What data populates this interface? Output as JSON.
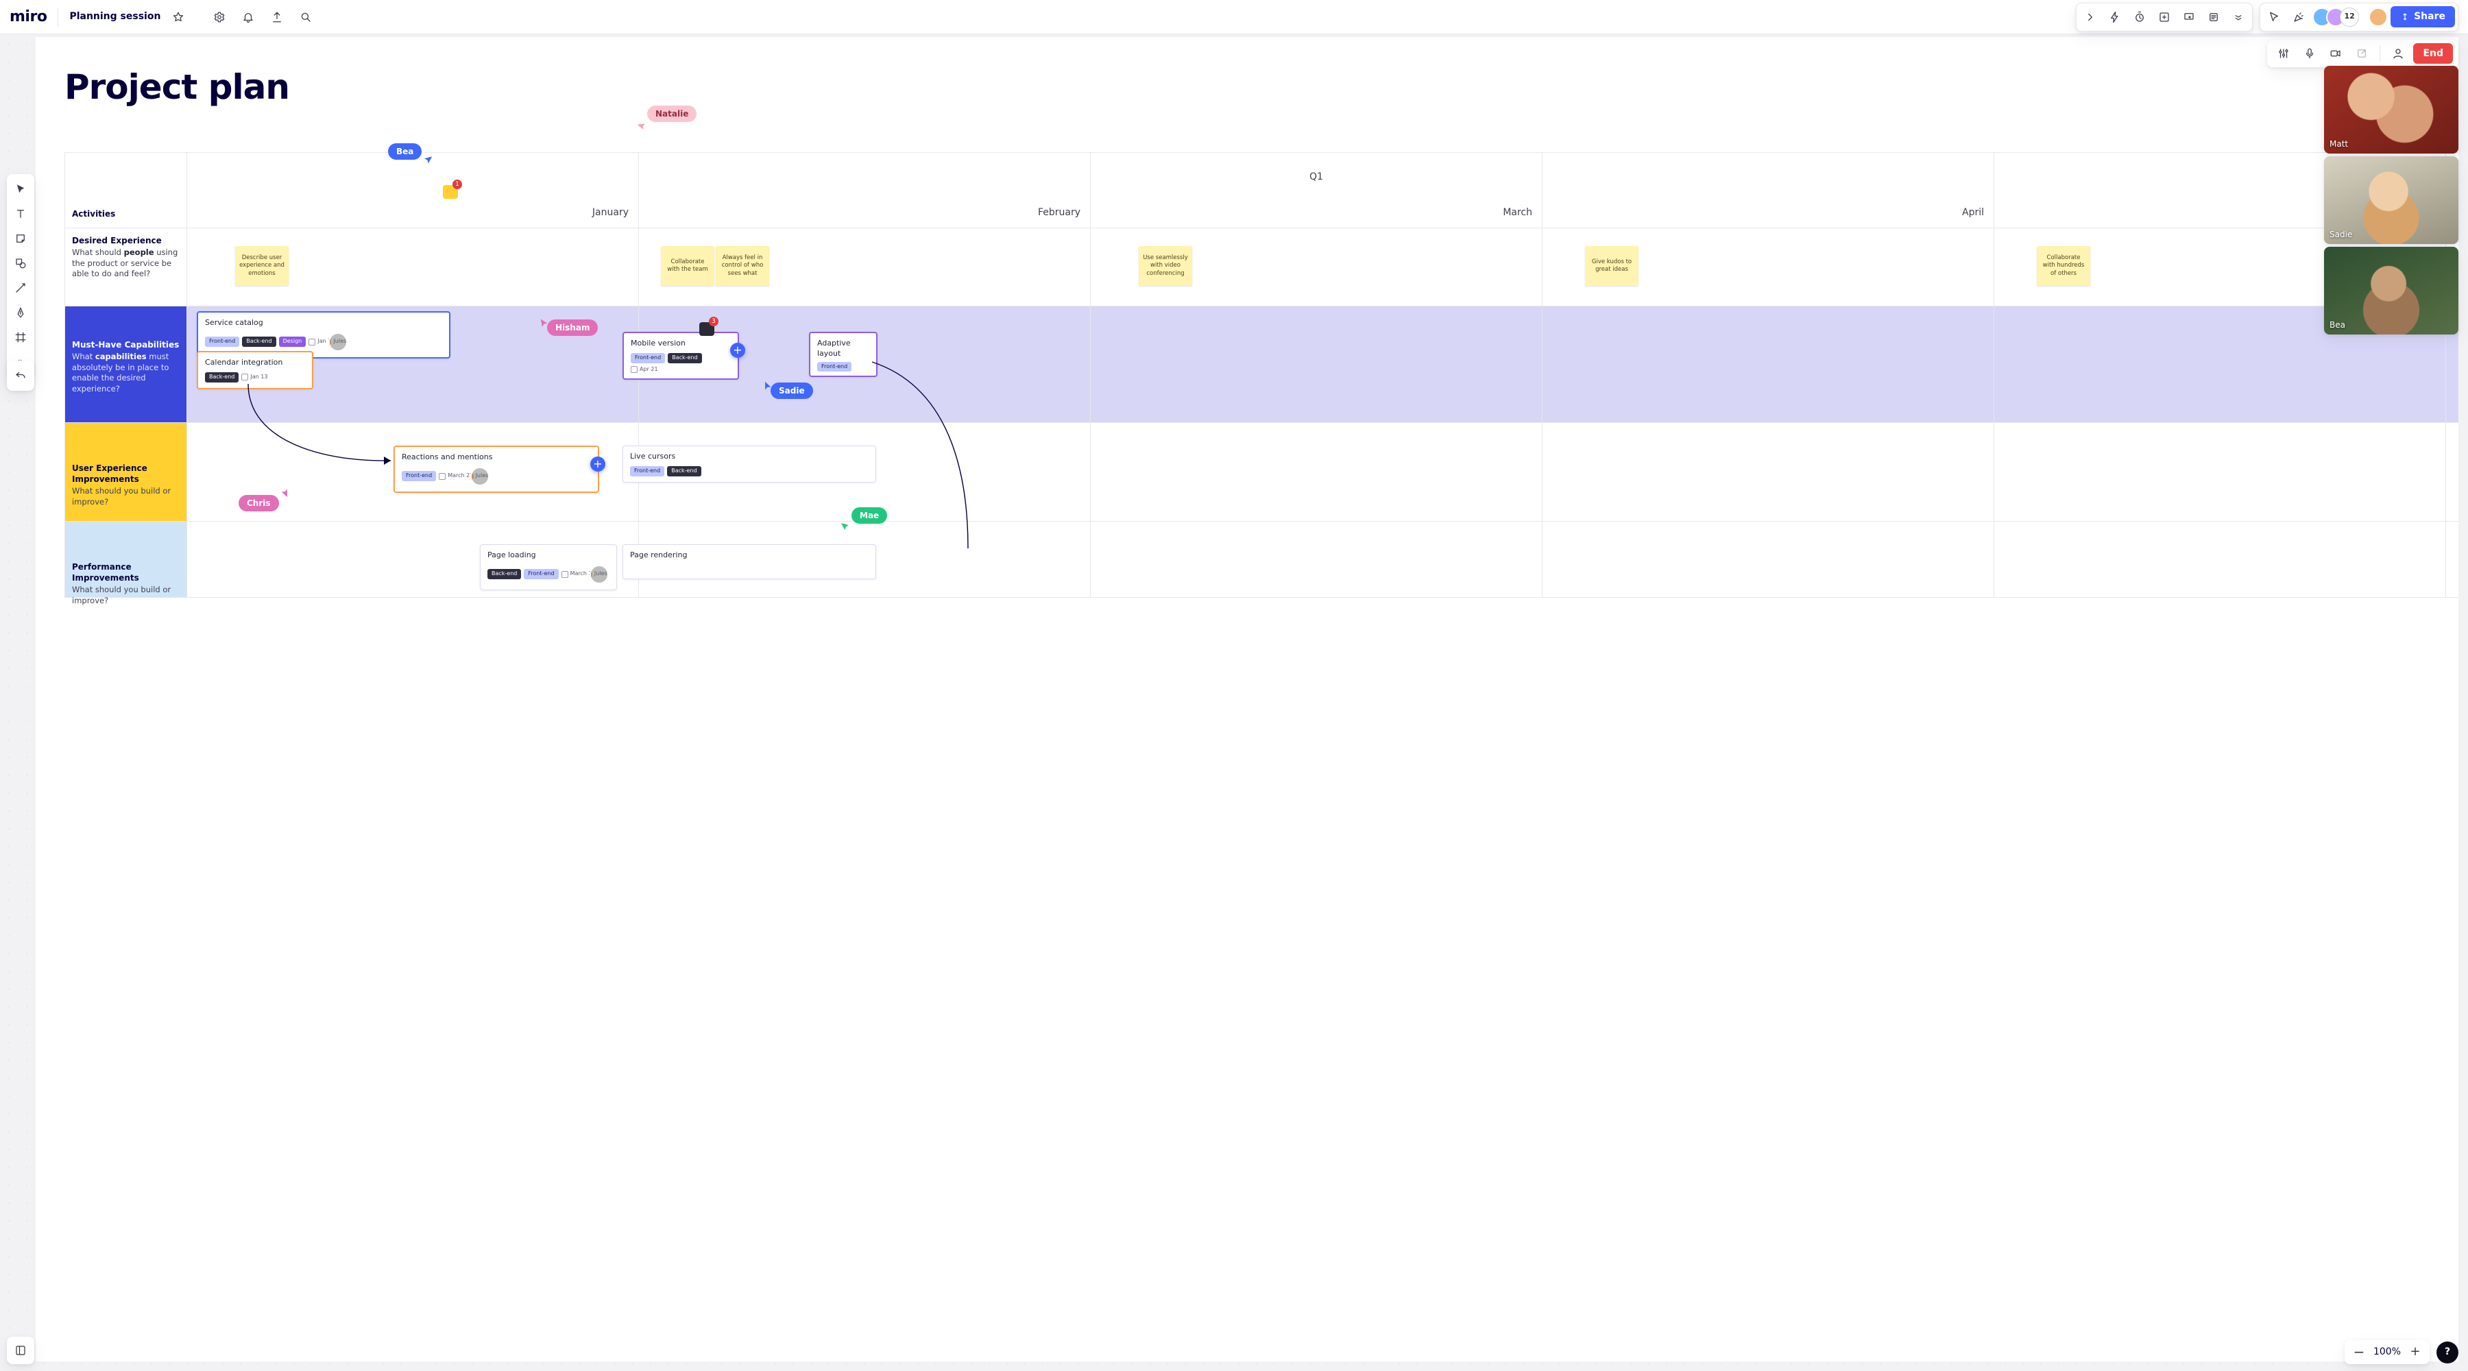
{
  "app": {
    "logo": "miro",
    "board_name": "Planning session"
  },
  "topbar_icons": {
    "star": "star-icon",
    "settings": "gear-icon",
    "notif": "bell-icon",
    "export": "upload-icon",
    "search": "search-icon"
  },
  "facilitation": {
    "chevron": ">",
    "bolt": "bolt-icon",
    "timer": "stopwatch-icon",
    "add": "plus-square-icon",
    "present": "presentation-icon",
    "list": "list-icon",
    "more": "chevron-down-icon"
  },
  "collab": {
    "cursor": "cursor-icon",
    "celebrate": "confetti-icon",
    "avatars": [
      {
        "bg": "#6fb7ff"
      },
      {
        "bg": "#c99cff"
      }
    ],
    "avatar_count": "12",
    "host": {
      "bg": "#f2b778"
    },
    "share_label": "Share"
  },
  "session": {
    "mixer": "sliders-icon",
    "mic": "mic-icon",
    "video": "video-icon",
    "popout": "popout-icon",
    "user": "user-icon",
    "end_label": "End"
  },
  "tools": [
    "select",
    "text",
    "sticky",
    "shape",
    "line",
    "pen",
    "frame",
    "more"
  ],
  "undo": "undo-icon",
  "zoom": {
    "minus": "−",
    "value": "100%",
    "plus": "+",
    "help": "?"
  },
  "board_title": "Project plan",
  "columns": {
    "activities": "Activities",
    "jan": "January",
    "feb": "February",
    "mar": "March",
    "apr": "April",
    "quarter": "Q1"
  },
  "rows": {
    "desire": {
      "hd": "Desired Experience",
      "sub_pre": "What should ",
      "sub_b": "people",
      "sub_post": " using the product or service be able to do and feel?"
    },
    "must": {
      "hd": "Must-Have Capabilities",
      "sub_pre": "What ",
      "sub_b": "capabilities",
      "sub_post": " must absolutely be in place to enable the desired experience?"
    },
    "ux": {
      "hd": "User Experience Improvements",
      "sub": "What should you build or improve?"
    },
    "perf": {
      "hd": "Performance Improvements",
      "sub": "What should you build or improve?"
    }
  },
  "stickies": {
    "s1": "Describe user experience and emotions",
    "s2": "Collaborate with the team",
    "s3": "Always feel in control of who sees what",
    "s4": "Use seamlessly with video conferencing",
    "s5": "Give kudos to great ideas",
    "s6": "Collaborate with hundreds of others"
  },
  "cards": {
    "svc": {
      "title": "Service catalog",
      "fe": "Front-end",
      "be": "Back-end",
      "ds": "Design",
      "date": "Jan 7",
      "who": "Jules"
    },
    "cal": {
      "title": "Calendar integration",
      "be": "Back-end",
      "date": "Jan 13"
    },
    "mobile": {
      "title": "Mobile version",
      "fe": "Front-end",
      "be": "Back-end",
      "date": "Apr 21"
    },
    "adaptive": {
      "title": "Adaptive layout",
      "fe": "Front-end"
    },
    "react": {
      "title": "Reactions and mentions",
      "fe": "Front-end",
      "date": "March 21",
      "who": "Jules"
    },
    "live": {
      "title": "Live cursors",
      "fe": "Front-end",
      "be": "Back-end"
    },
    "pload": {
      "title": "Page loading",
      "be": "Back-end",
      "fe": "Front-end",
      "date": "March 3",
      "who": "Jules"
    },
    "prender": {
      "title": "Page rendering"
    }
  },
  "presence": {
    "bea": "Bea",
    "sadie": "Sadie",
    "hisham": "Hisham",
    "natalie": "Natalie",
    "chris": "Chris",
    "mae": "Mae"
  },
  "badges": {
    "comment1": "1",
    "comment2": "3"
  },
  "videos": {
    "matt": "Matt",
    "sadie": "Sadie",
    "bea": "Bea"
  }
}
